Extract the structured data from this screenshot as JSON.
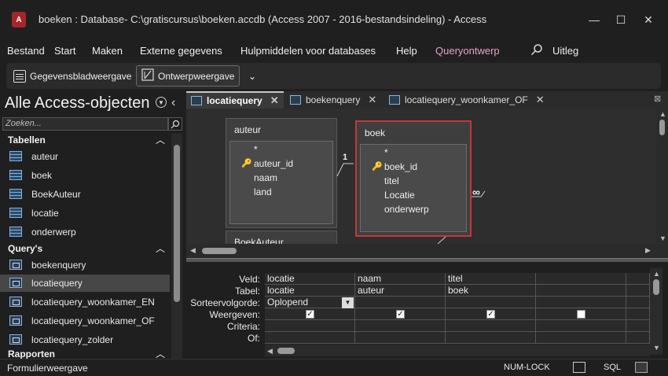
{
  "window": {
    "title": "boeken : Database- C:\\gratiscursus\\boeken.accdb (Access 2007 - 2016-bestandsindeling)  -  Access",
    "app_icon_letter": "A",
    "controls": {
      "minimize": "—",
      "maximize": "☐",
      "close": "✕"
    }
  },
  "menu": {
    "items": [
      "Bestand",
      "Start",
      "Maken",
      "Externe gegevens",
      "Hulpmiddelen voor databases",
      "Help",
      "Queryontwerp"
    ],
    "help_label": "Uitleg"
  },
  "toolbar": {
    "datasheet_label": "Gegevensbladweergave",
    "design_label": "Ontwerpweergave",
    "more_label": "⌄"
  },
  "navpane": {
    "title": "Alle Access-objecten",
    "search_placeholder": "Zoeken...",
    "groups": [
      {
        "label": "Tabellen",
        "items": [
          "auteur",
          "boek",
          "BoekAuteur",
          "locatie",
          "onderwerp"
        ]
      },
      {
        "label": "Query's",
        "items": [
          "boekenquery",
          "locatiequery",
          "locatiequery_woonkamer_EN",
          "locatiequery_woonkamer_OF",
          "locatiequery_zolder"
        ]
      },
      {
        "label": "Rapporten",
        "items": []
      }
    ],
    "selected_item": "locatiequery"
  },
  "tabs": [
    "locatiequery",
    "boekenquery",
    "locatiequery_woonkamer_OF"
  ],
  "design": {
    "tables": [
      {
        "name": "auteur",
        "fields": [
          "*",
          "auteur_id",
          "naam",
          "land"
        ],
        "key_field": "auteur_id"
      },
      {
        "name": "boek",
        "fields": [
          "*",
          "boek_id",
          "titel",
          "Locatie",
          "onderwerp"
        ],
        "key_field": "boek_id"
      },
      {
        "name": "BoekAuteur",
        "fields": []
      }
    ],
    "relation_one": "1",
    "relation_many": "∞"
  },
  "grid": {
    "row_labels": [
      "Veld:",
      "Tabel:",
      "Sorteervolgorde:",
      "Weergeven:",
      "Criteria:",
      "Of:"
    ],
    "columns": [
      {
        "veld": "locatie",
        "tabel": "locatie",
        "sort": "Oplopend",
        "show": true
      },
      {
        "veld": "naam",
        "tabel": "auteur",
        "sort": "",
        "show": true
      },
      {
        "veld": "titel",
        "tabel": "boek",
        "sort": "",
        "show": true
      },
      {
        "veld": "",
        "tabel": "",
        "sort": "",
        "show": false
      }
    ]
  },
  "statusbar": {
    "left": "Formulierweergave",
    "numlock": "NUM-LOCK",
    "sql": "SQL"
  }
}
